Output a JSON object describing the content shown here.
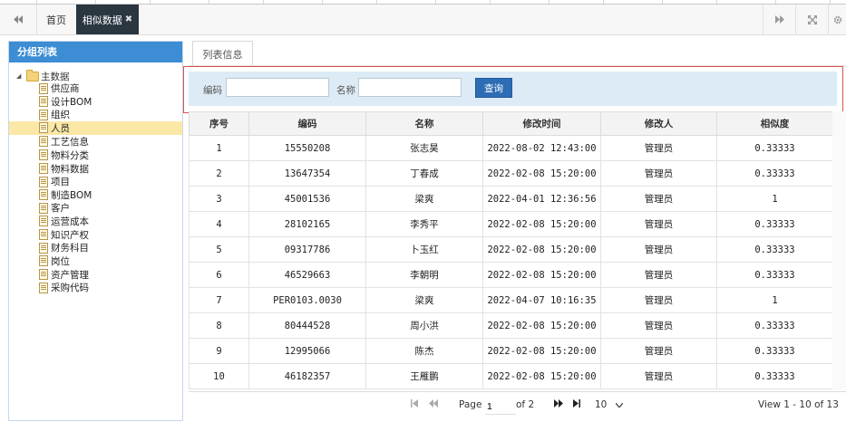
{
  "tabs": {
    "home": "首页",
    "active": "相似数据",
    "close": "✖"
  },
  "left": {
    "title": "分组列表",
    "root": "主数据",
    "items": [
      "供应商",
      "设计BOM",
      "组织",
      "人员",
      "工艺信息",
      "物料分类",
      "物料数据",
      "项目",
      "制造BOM",
      "客户",
      "运营成本",
      "知识产权",
      "财务科目",
      "岗位",
      "资产管理",
      "采购代码"
    ],
    "selected_index": 3
  },
  "content": {
    "subtab": "列表信息"
  },
  "search": {
    "code_label": "编码",
    "code_value": "",
    "name_label": "名称",
    "name_value": "",
    "button": "查询"
  },
  "table": {
    "headers": [
      "序号",
      "编码",
      "名称",
      "修改时间",
      "修改人",
      "相似度"
    ],
    "rows": [
      [
        "1",
        "15550208",
        "张志昊",
        "2022-08-02 12:43:00",
        "管理员",
        "0.33333"
      ],
      [
        "2",
        "13647354",
        "丁春成",
        "2022-02-08 15:20:00",
        "管理员",
        "0.33333"
      ],
      [
        "3",
        "45001536",
        "梁爽",
        "2022-04-01 12:36:56",
        "管理员",
        "1"
      ],
      [
        "4",
        "28102165",
        "李秀平",
        "2022-02-08 15:20:00",
        "管理员",
        "0.33333"
      ],
      [
        "5",
        "09317786",
        "卜玉红",
        "2022-02-08 15:20:00",
        "管理员",
        "0.33333"
      ],
      [
        "6",
        "46529663",
        "李朝明",
        "2022-02-08 15:20:00",
        "管理员",
        "0.33333"
      ],
      [
        "7",
        "PER0103.0030",
        "梁爽",
        "2022-04-07 10:16:35",
        "管理员",
        "1"
      ],
      [
        "8",
        "80444528",
        "周小洪",
        "2022-02-08 15:20:00",
        "管理员",
        "0.33333"
      ],
      [
        "9",
        "12995066",
        "陈杰",
        "2022-02-08 15:20:00",
        "管理员",
        "0.33333"
      ],
      [
        "10",
        "46182357",
        "王雁鹏",
        "2022-02-08 15:20:00",
        "管理员",
        "0.33333"
      ]
    ]
  },
  "pager": {
    "page_label": "Page",
    "page_value": "1",
    "of_label": "of 2",
    "page_size": "10",
    "view_text": "View 1 - 10 of 13"
  },
  "icons": {
    "prev_tab": "double-left-arrow",
    "next_tab": "double-right-arrow",
    "fullscreen": "expand-icon",
    "settings": "gear-icon",
    "first": "first-page-icon",
    "prev": "prev-page-icon",
    "next": "next-page-icon",
    "last": "last-page-icon"
  },
  "colors": {
    "header_blue": "#3c8dd3",
    "active_tab": "#2a3640",
    "search_bg": "#dcebf5",
    "selected_row": "#fbe7a6",
    "search_button": "#2d6db5",
    "highlight_border": "#d9534f"
  }
}
